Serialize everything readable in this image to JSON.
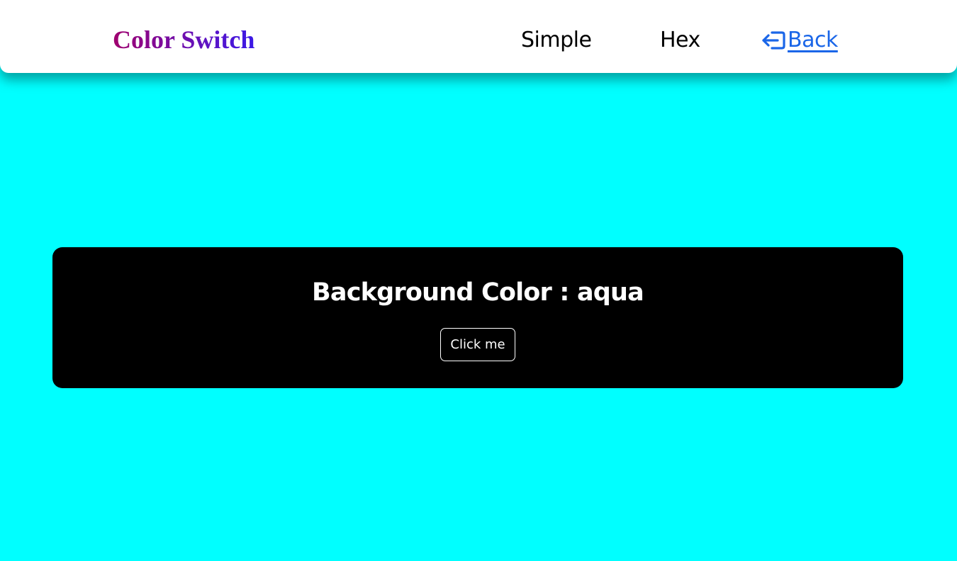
{
  "navbar": {
    "brand": "Color Switch",
    "links": {
      "simple": "Simple",
      "hex": "Hex",
      "back": " Back"
    },
    "back_icon": "box-arrow-in-left-icon",
    "colors": {
      "background": "#ffffff",
      "brand_gradient_start": "#a0006e",
      "brand_gradient_end": "#3a18e6",
      "link_text": "#000000",
      "back_link": "#1a66e8"
    }
  },
  "page": {
    "background_color": "#00ffff"
  },
  "card": {
    "title": "Background Color : aqua",
    "button_label": "Click me",
    "colors": {
      "background": "#000000",
      "text": "#ffffff"
    }
  }
}
